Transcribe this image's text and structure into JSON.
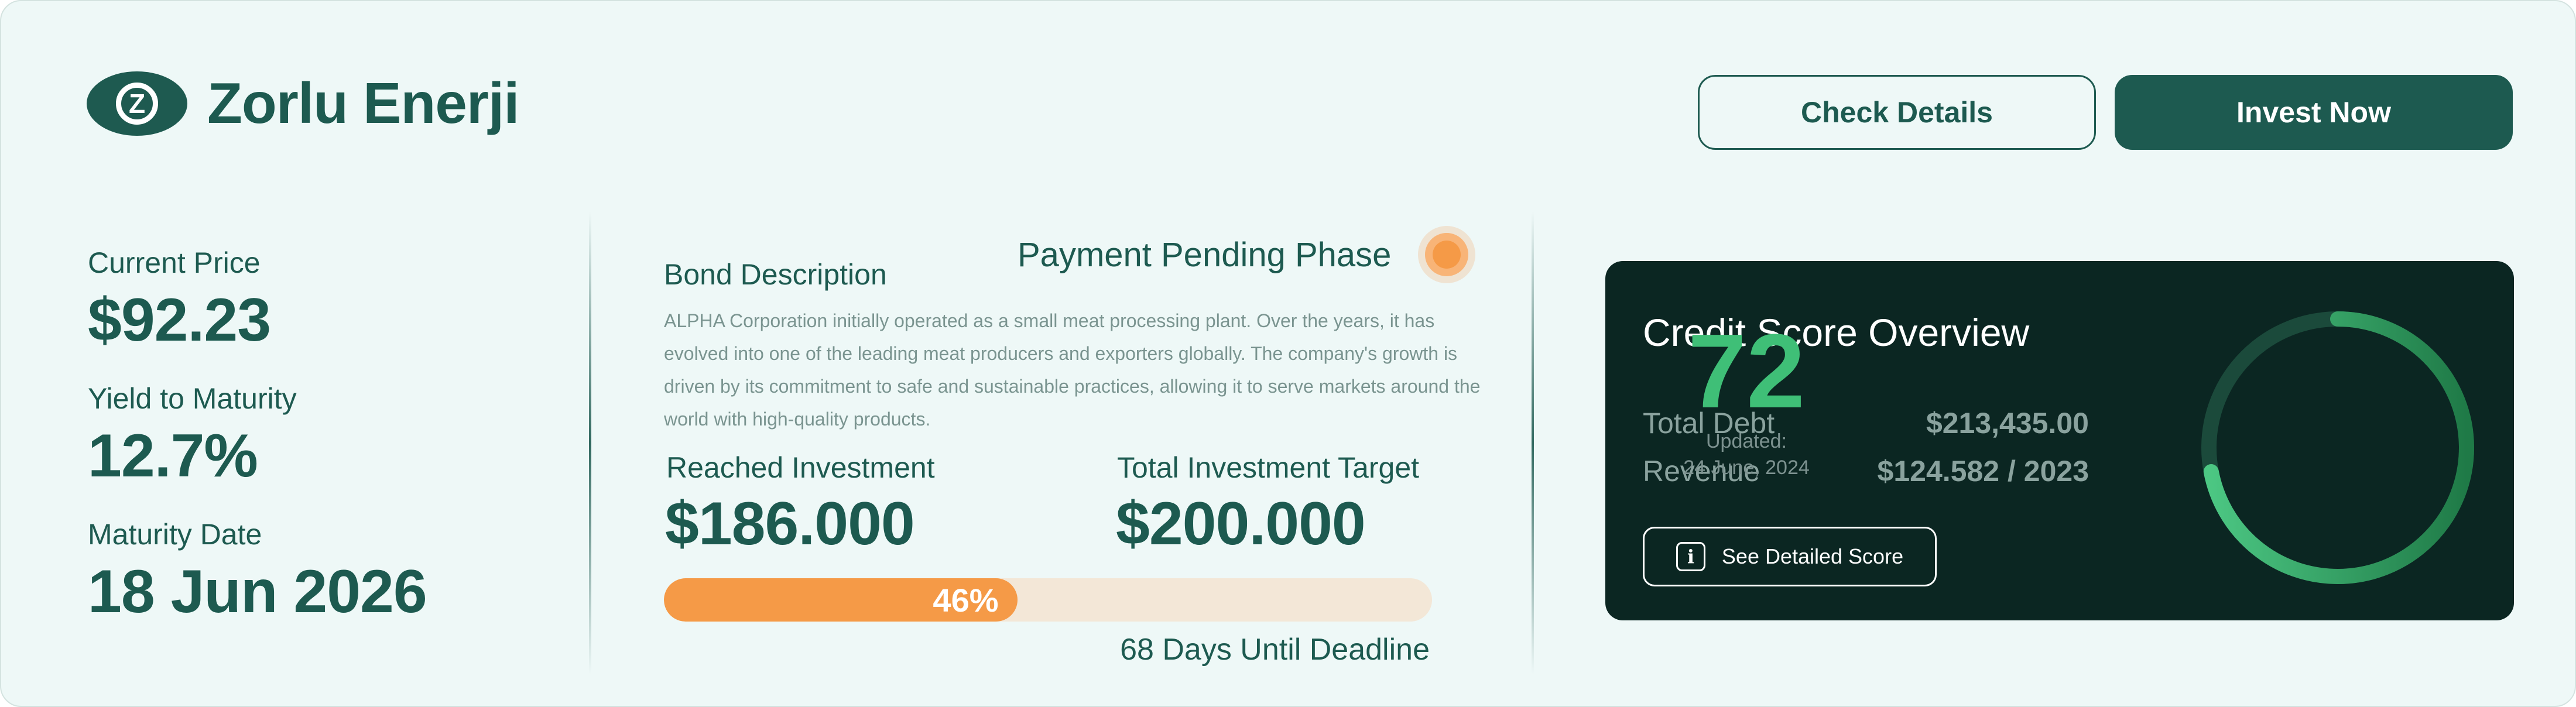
{
  "brand": {
    "logo_letter": "Z",
    "name": "Zorlu Enerji"
  },
  "header": {
    "check_details_label": "Check Details",
    "invest_now_label": "Invest Now"
  },
  "stats": {
    "current_price_label": "Current Price",
    "current_price_value": "$92.23",
    "yield_label": "Yield to Maturity",
    "yield_value": "12.7%",
    "maturity_label": "Maturity Date",
    "maturity_value": "18 Jun 2026"
  },
  "bond": {
    "title": "Bond Description",
    "phase": "Payment Pending Phase",
    "phase_color": "#f59a47",
    "description": "ALPHA Corporation initially operated as a small meat processing plant. Over the years, it has evolved into one of the leading meat producers and exporters globally. The company's growth is driven by its commitment to safe and sustainable practices, allowing it to serve markets around the world with high-quality products.",
    "reached_label": "Reached Investment",
    "reached_value": "$186.000",
    "target_label": "Total Investment Target",
    "target_value": "$200.000",
    "progress_percent": 46,
    "progress_text": "46%",
    "deadline": "68 Days Until Deadline"
  },
  "credit": {
    "title": "Credit Score Overview",
    "total_debt_label": "Total Debt",
    "total_debt_value": "$213,435.00",
    "revenue_label": "Revenue",
    "revenue_value": "$124.582 / 2023",
    "detail_button_label": "See Detailed Score",
    "detail_icon": "info-icon",
    "score": 72,
    "score_max": 100,
    "updated_label": "Updated:",
    "updated_date": "24 June, 2024"
  },
  "colors": {
    "primary": "#1d5a50",
    "background": "#eef8f7",
    "accent_orange": "#f59a47",
    "credit_card_bg": "#0b2622",
    "gauge_green": "#3fbf77"
  }
}
